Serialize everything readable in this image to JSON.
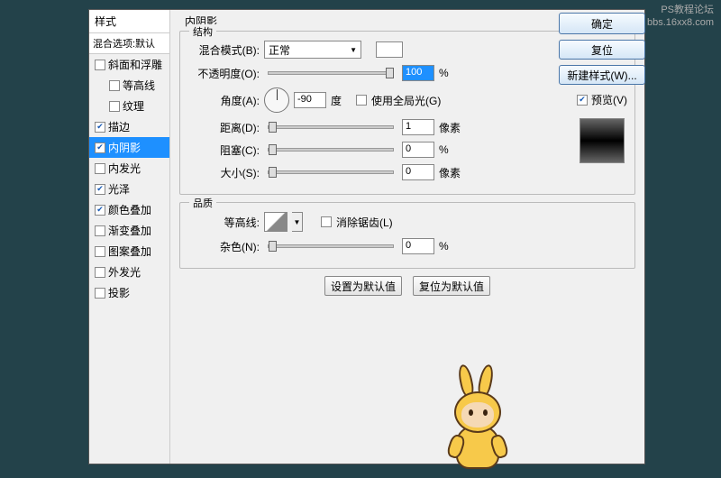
{
  "watermark": {
    "line1": "PS教程论坛",
    "line2": "bbs.16xx8.com"
  },
  "styles": {
    "header": "样式",
    "blend_options": "混合选项:默认",
    "items": [
      {
        "label": "斜面和浮雕",
        "checked": false,
        "indent": false
      },
      {
        "label": "等高线",
        "checked": false,
        "indent": true
      },
      {
        "label": "纹理",
        "checked": false,
        "indent": true
      },
      {
        "label": "描边",
        "checked": true,
        "indent": false
      },
      {
        "label": "内阴影",
        "checked": true,
        "indent": false,
        "selected": true
      },
      {
        "label": "内发光",
        "checked": false,
        "indent": false
      },
      {
        "label": "光泽",
        "checked": true,
        "indent": false
      },
      {
        "label": "颜色叠加",
        "checked": true,
        "indent": false
      },
      {
        "label": "渐变叠加",
        "checked": false,
        "indent": false
      },
      {
        "label": "图案叠加",
        "checked": false,
        "indent": false
      },
      {
        "label": "外发光",
        "checked": false,
        "indent": false
      },
      {
        "label": "投影",
        "checked": false,
        "indent": false
      }
    ]
  },
  "panel_title": "内阴影",
  "structure": {
    "legend": "结构",
    "blend_mode_label": "混合模式(B):",
    "blend_mode_value": "正常",
    "opacity_label": "不透明度(O):",
    "opacity_value": "100",
    "opacity_unit": "%",
    "angle_label": "角度(A):",
    "angle_value": "-90",
    "angle_unit": "度",
    "global_light_label": "使用全局光(G)",
    "global_light_checked": false,
    "distance_label": "距离(D):",
    "distance_value": "1",
    "distance_unit": "像素",
    "choke_label": "阻塞(C):",
    "choke_value": "0",
    "choke_unit": "%",
    "size_label": "大小(S):",
    "size_value": "0",
    "size_unit": "像素"
  },
  "quality": {
    "legend": "品质",
    "contour_label": "等高线:",
    "antialias_label": "消除锯齿(L)",
    "antialias_checked": false,
    "noise_label": "杂色(N):",
    "noise_value": "0",
    "noise_unit": "%"
  },
  "buttons": {
    "set_default": "设置为默认值",
    "reset_default": "复位为默认值"
  },
  "right": {
    "ok": "确定",
    "cancel": "复位",
    "new_style": "新建样式(W)...",
    "preview_label": "预览(V)",
    "preview_checked": true
  }
}
